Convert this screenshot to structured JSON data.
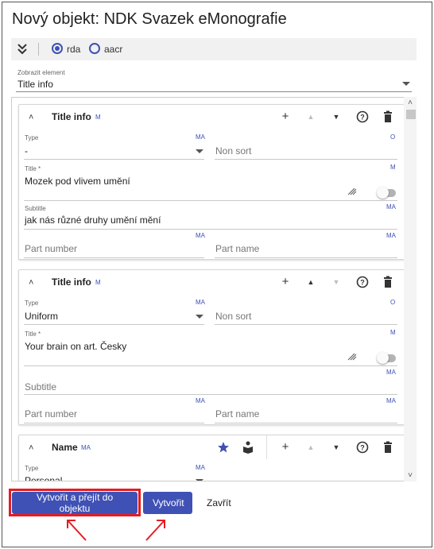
{
  "dialog": {
    "title": "Nový objekt: NDK Svazek eMonografie"
  },
  "toolbar": {
    "radio_options": [
      "rda",
      "aacr"
    ],
    "selected": "rda"
  },
  "element_select": {
    "label": "Zobrazit element",
    "value": "Title info"
  },
  "cards": [
    {
      "title": "Title info",
      "badge": "M",
      "type": {
        "label": "Type",
        "value": "-",
        "badge": "MA"
      },
      "non_sort": {
        "placeholder": "Non sort",
        "badge": "O"
      },
      "title_field": {
        "label": "Title *",
        "value": "Mozek pod vlivem umění",
        "badge": "M"
      },
      "subtitle": {
        "label": "Subtitle",
        "value": "jak nás různé druhy umění mění",
        "badge": "MA"
      },
      "part_number": {
        "placeholder": "Part number",
        "badge": "MA"
      },
      "part_name": {
        "placeholder": "Part name",
        "badge": "MA"
      }
    },
    {
      "title": "Title info",
      "badge": "M",
      "type": {
        "label": "Type",
        "value": "Uniform",
        "badge": "MA"
      },
      "non_sort": {
        "placeholder": "Non sort",
        "badge": "O"
      },
      "title_field": {
        "label": "Title *",
        "value": "Your brain on art. Česky",
        "badge": "M"
      },
      "subtitle": {
        "placeholder": "Subtitle",
        "badge": "MA"
      },
      "part_number": {
        "placeholder": "Part number",
        "badge": "MA"
      },
      "part_name": {
        "placeholder": "Part name",
        "badge": "MA"
      }
    },
    {
      "title": "Name",
      "badge": "MA",
      "type": {
        "label": "Type",
        "value": "Personal",
        "badge": "MA"
      }
    }
  ],
  "footer": {
    "create_and_open": "Vytvořit a přejít do objektu",
    "create": "Vytvořit",
    "close": "Zavřít"
  },
  "colors": {
    "accent": "#3f51b5",
    "highlight": "#e41c23"
  }
}
